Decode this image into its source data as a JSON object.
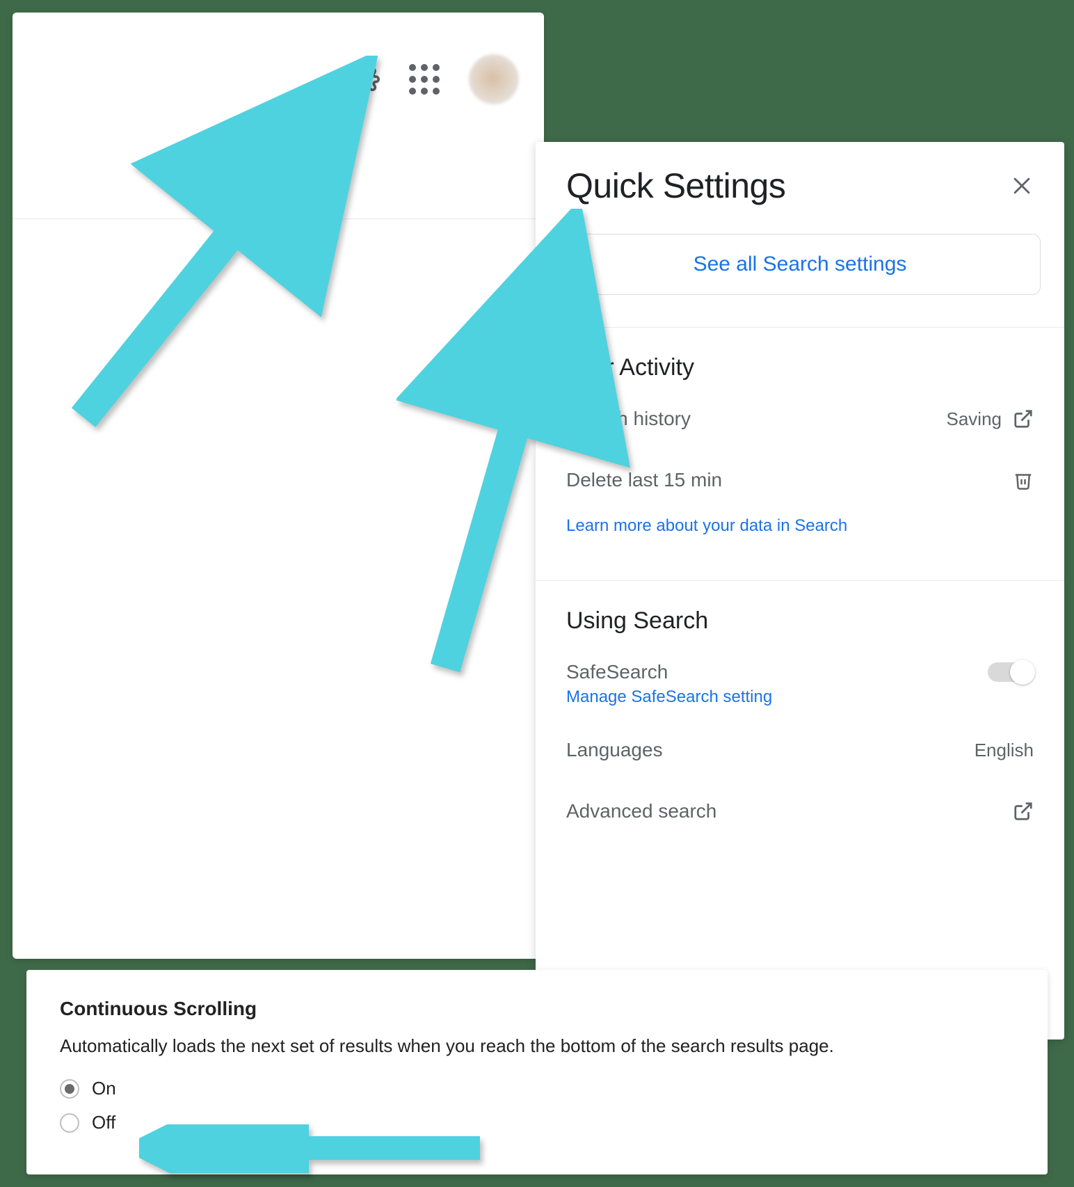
{
  "header": {
    "icons": {
      "gear": "gear-icon",
      "apps": "apps-icon",
      "avatar": "avatar"
    }
  },
  "quick_settings": {
    "title": "Quick Settings",
    "see_all_label": "See all Search settings",
    "activity": {
      "section_title": "Your Activity",
      "search_history_label": "Search history",
      "search_history_status": "Saving",
      "delete_label": "Delete last 15 min",
      "learn_more_label": "Learn more about your data in Search"
    },
    "using_search": {
      "section_title": "Using Search",
      "safesearch_label": "SafeSearch",
      "safesearch_manage": "Manage SafeSearch setting",
      "languages_label": "Languages",
      "languages_value": "English",
      "advanced_label": "Advanced search"
    }
  },
  "continuous_scrolling": {
    "title": "Continuous Scrolling",
    "description": "Automatically loads the next set of results when you reach the bottom of the search results page.",
    "option_on": "On",
    "option_off": "Off",
    "selected": "on"
  },
  "colors": {
    "accent_blue": "#1a73e8",
    "annotation_cyan": "#4ed2e0"
  }
}
